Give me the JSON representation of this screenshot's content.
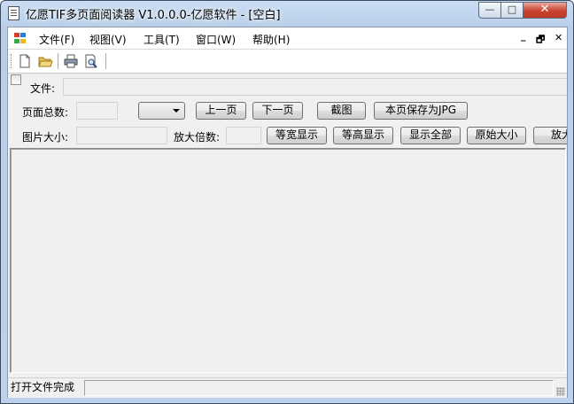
{
  "window": {
    "title": "亿愿TIF多页面阅读器 V1.0.0.0-亿愿软件 - [空白]"
  },
  "title_buttons": {
    "minimize": "—",
    "maximize": "□",
    "close": "✕"
  },
  "menu": {
    "items": [
      "文件(F)",
      "视图(V)",
      "工具(T)",
      "窗口(W)",
      "帮助(H)"
    ],
    "mdi_minimize": "_",
    "mdi_restore": "🗗",
    "mdi_close": "✕"
  },
  "toolbar": {
    "buttons": [
      "new-icon",
      "open-folder-icon",
      "print-icon",
      "print-preview-icon"
    ]
  },
  "form": {
    "file_label": "文件:",
    "file_value": "",
    "page_total_label": "页面总数:",
    "page_total_value": "",
    "page_select_value": "",
    "prev_page": "上一页",
    "next_page": "下一页",
    "screenshot": "截图",
    "save_jpg": "本页保存为JPG",
    "image_size_label": "图片大小:",
    "image_size_value": "",
    "zoom_label": "放大倍数:",
    "zoom_value": "",
    "fit_width": "等宽显示",
    "fit_height": "等高显示",
    "show_all": "显示全部",
    "original_size": "原始大小",
    "zoom_in": "放大"
  },
  "status": {
    "text": "打开文件完成",
    "secondary": ""
  }
}
